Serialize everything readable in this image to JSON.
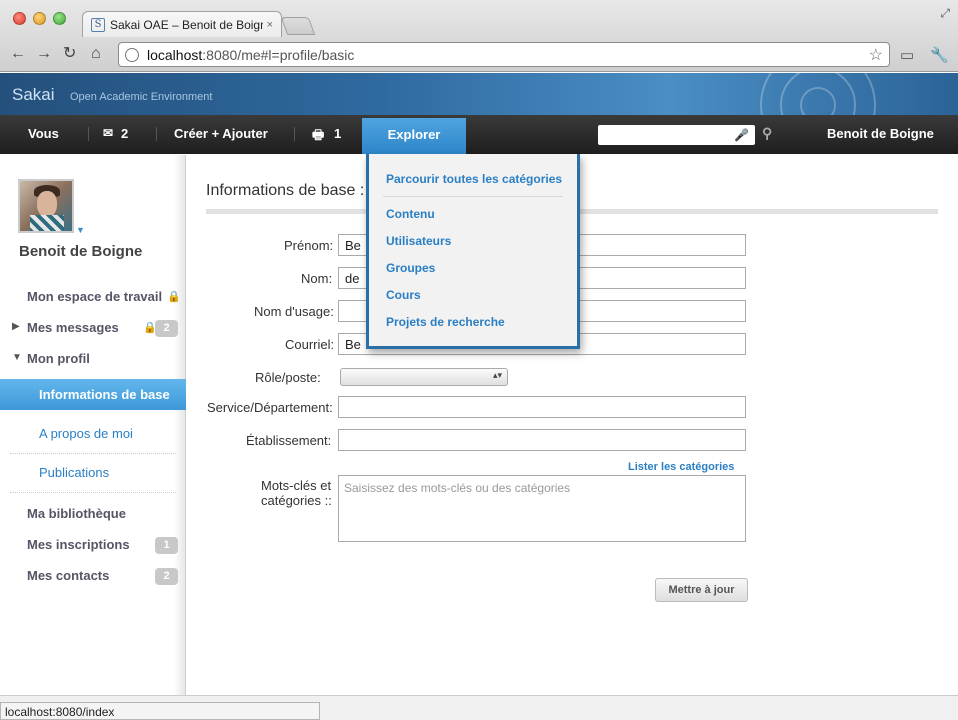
{
  "browser": {
    "tab_title": "Sakai OAE – Benoit de Boigne",
    "tab_favicon": "S",
    "tab_close": "×",
    "url_host": "localhost",
    "url_path": ":8080/me#l=profile/basic",
    "status_text": "localhost:8080/index"
  },
  "banner": {
    "logo": "Sakai",
    "subtitle": "Open Academic Environment"
  },
  "topnav": {
    "you": "Vous",
    "messages_count": "2",
    "create_add": "Créer + Ajouter",
    "inbox_count": "1",
    "explore": "Explorer",
    "user_name": "Benoit de Boigne"
  },
  "search": {
    "placeholder": ""
  },
  "sidebar": {
    "name": "Benoit de Boigne",
    "my_space": "Mon espace de travail",
    "my_messages": "Mes messages",
    "messages_badge": "2",
    "my_profile": "Mon profil",
    "basic_info": "Informations de base",
    "about_me": "A propos de moi",
    "publications": "Publications",
    "my_library": "Ma bibliothèque",
    "my_memberships": "Mes inscriptions",
    "memberships_badge": "1",
    "my_contacts": "Mes contacts",
    "contacts_badge": "2"
  },
  "form": {
    "title": "Informations de base :",
    "firstname_label": "Prénom:",
    "firstname_value": "Be",
    "lastname_label": "Nom:",
    "lastname_value": "de",
    "nickname_label": "Nom d'usage:",
    "email_label": "Courriel:",
    "email_value": "Be",
    "role_label": "Rôle/poste:",
    "department_label": "Service/Département:",
    "institution_label": "Établissement:",
    "list_categories": "Lister les catégories",
    "tags_label_1": "Mots-clés et",
    "tags_label_2": "catégories ::",
    "tags_placeholder": "Saisissez des mots-clés ou des catégories",
    "update_button": "Mettre à jour"
  },
  "explore_menu": {
    "browse_all": "Parcourir toutes les catégories",
    "content": "Contenu",
    "users": "Utilisateurs",
    "groups": "Groupes",
    "courses": "Cours",
    "research": "Projets de recherche"
  }
}
